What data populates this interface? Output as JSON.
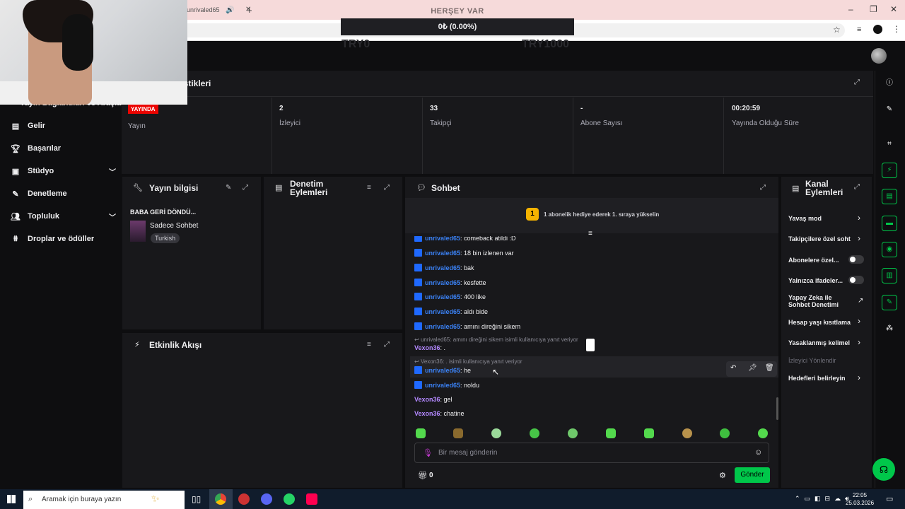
{
  "browser": {
    "tab_title": "unrivaled65",
    "tab_close": "✕",
    "new_tab": "+"
  },
  "overlay": {
    "title": "HERŞEY VAR",
    "progress": "0₺ (0.00%)",
    "goal_start": "TRY0",
    "goal_end": "TRY1000"
  },
  "nav": {
    "hidden_item": "Yayın Bağlantıları ve Araçları",
    "items": [
      {
        "label": "Gelir",
        "icon": "revenue-icon"
      },
      {
        "label": "Başarılar",
        "icon": "trophy-icon"
      },
      {
        "label": "Stüdyo",
        "icon": "studio-icon"
      },
      {
        "label": "Denetleme",
        "icon": "wrench-icon"
      },
      {
        "label": "Topluluk",
        "icon": "community-icon"
      },
      {
        "label": "Droplar ve ödüller",
        "icon": "drops-icon"
      }
    ]
  },
  "stats": {
    "title": "Oturum İstatistikleri",
    "live_badge": "YAYINDA",
    "cells": [
      {
        "value": "",
        "label": "Yayın"
      },
      {
        "value": "2",
        "label": "İzleyici"
      },
      {
        "value": "33",
        "label": "Takipçi"
      },
      {
        "value": "-",
        "label": "Abone Sayısı"
      },
      {
        "value": "00:20:59",
        "label": "Yayında Olduğu Süre"
      }
    ]
  },
  "stream_info": {
    "title": "Yayın bilgisi",
    "stream_title": "BABA GERİ DÖNDÜ...",
    "category": "Sadece Sohbet",
    "tag": "Turkish"
  },
  "mod_actions": {
    "title": "Denetim Eylemleri"
  },
  "activity": {
    "title": "Etkinlik Akışı"
  },
  "chat": {
    "title": "Sohbet",
    "gift_rank": "1",
    "gift_text": "1 abonelik hediye ederek 1. sıraya yükselin",
    "messages": [
      {
        "user": "unrivaled65",
        "text": ": comeback atildi :D"
      },
      {
        "user": "unrivaled65",
        "text": ": 18 bin izlenen var"
      },
      {
        "user": "unrivaled65",
        "text": ": bak"
      },
      {
        "user": "unrivaled65",
        "text": ": kesfette"
      },
      {
        "user": "unrivaled65",
        "text": ": 400 like"
      },
      {
        "user": "unrivaled65",
        "text": ": aldı bide"
      },
      {
        "user": "unrivaled65",
        "text": ": amını direğini sikem"
      }
    ],
    "reply1_hint": "unrivaled65: amını direğini sikem isimli kullanıcıya yanıt veriyor",
    "reply1_user": "Vexon36",
    "reply1_text": ": .",
    "reply2_hint": "Vexon36: . isimli kullanıcıya yanıt veriyor",
    "reply2_user": "unrivaled65",
    "reply2_text": ": he",
    "tail": [
      {
        "user": "unrivaled65",
        "text": ": noldu",
        "kind": "u1"
      },
      {
        "user": "Vexon36",
        "text": ": gel",
        "kind": "u2"
      },
      {
        "user": "Vexon36",
        "text": ": chatine",
        "kind": "u2"
      }
    ],
    "input_placeholder": "Bir mesaj gönderin",
    "points": "0",
    "send_label": "Gönder"
  },
  "channel_actions": {
    "title": "Kanal Eylemleri",
    "items": [
      {
        "label": "Yavaş mod",
        "control": "chevron"
      },
      {
        "label": "Takipçilere özel soht",
        "control": "chevron"
      },
      {
        "label": "Abonelere özel...",
        "control": "switch"
      },
      {
        "label": "Yalnızca ifadeler...",
        "control": "switch"
      },
      {
        "label": "Yapay Zeka ile Sohbet Denetimi",
        "control": "link"
      },
      {
        "label": "Hesap yaşı kısıtlama",
        "control": "chevron"
      },
      {
        "label": "Yasaklanmış kelimel",
        "control": "chevron"
      },
      {
        "label": "İzleyici Yönlendir",
        "control": "none"
      },
      {
        "label": "Hedefleri belirleyin",
        "control": "chevron"
      }
    ]
  },
  "taskbar": {
    "search_placeholder": "Aramak için buraya yazın",
    "time": "22:05",
    "date": "25.03.2026"
  },
  "colors": {
    "accent_green": "#00c74a",
    "live_red": "#eb0400",
    "user_blue": "#3b82f6",
    "user_purple": "#b388ff"
  }
}
